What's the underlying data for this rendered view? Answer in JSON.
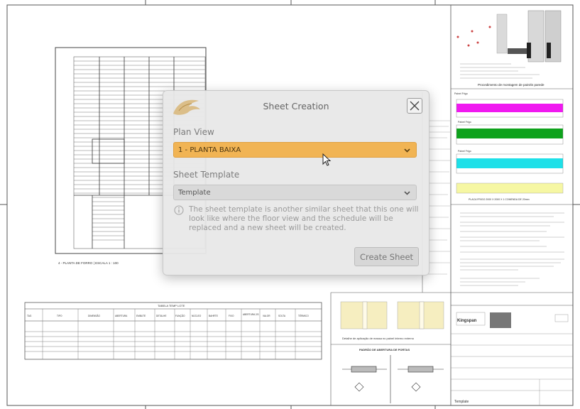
{
  "dialog": {
    "title": "Sheet Creation",
    "plan_view_label": "Plan View",
    "plan_view_value": "1 - PLANTA BAIXA",
    "sheet_template_label": "Sheet Template",
    "sheet_template_value": "Template",
    "info_text": "The sheet template is another similar sheet that this one will look like where the floor view and the schedule will be replaced and a new sheet will be created.",
    "create_button": "Create Sheet",
    "accent_color": "#f1b454"
  },
  "drawing": {
    "plan_caption": "4 - PLANTA DE FORRO | ESCALA 1 : 100",
    "schedule_title": "TABELA TEMP LOTE",
    "schedule_headers": [
      "TAG",
      "TIPO",
      "DIMENSÃO",
      "ABERTURA",
      "EMBUTE",
      "DETALHE",
      "FUNÇÃO",
      "NÚCLEO",
      "BAHRTE",
      "FIXO",
      "ABERTURA 2/3",
      "VALOR",
      "SOLTA",
      "TÉRMICO"
    ],
    "right_caption": "Procedimento de montagem de painéis parede",
    "panel_rows": [
      "Painel Frigo",
      "Painel Frigo",
      "Painel Frigo",
      "Painel Frigo"
    ],
    "bottom_right_caption": "PLACA FRIGO 2000 X 2000 X 1 COMENDA DE 20mm",
    "joint_caption": "Detalhe de aplicação de massa no painel interno externo",
    "drawing_title": "PADRÃO DE ABERTURA DE PORTAS",
    "stamp_label": "Template",
    "brand": "Kingspan"
  }
}
